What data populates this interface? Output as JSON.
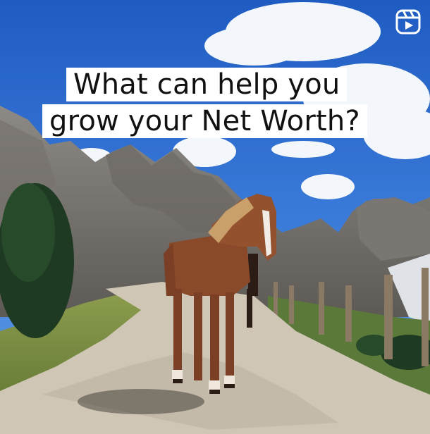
{
  "caption": {
    "line1": "What can help you",
    "line2": "grow your Net Worth?"
  },
  "overlay": {
    "icon": "reels-icon"
  },
  "colors": {
    "sky": "#2f6fd0",
    "caption_bg": "#ffffff",
    "caption_text": "#111111"
  }
}
